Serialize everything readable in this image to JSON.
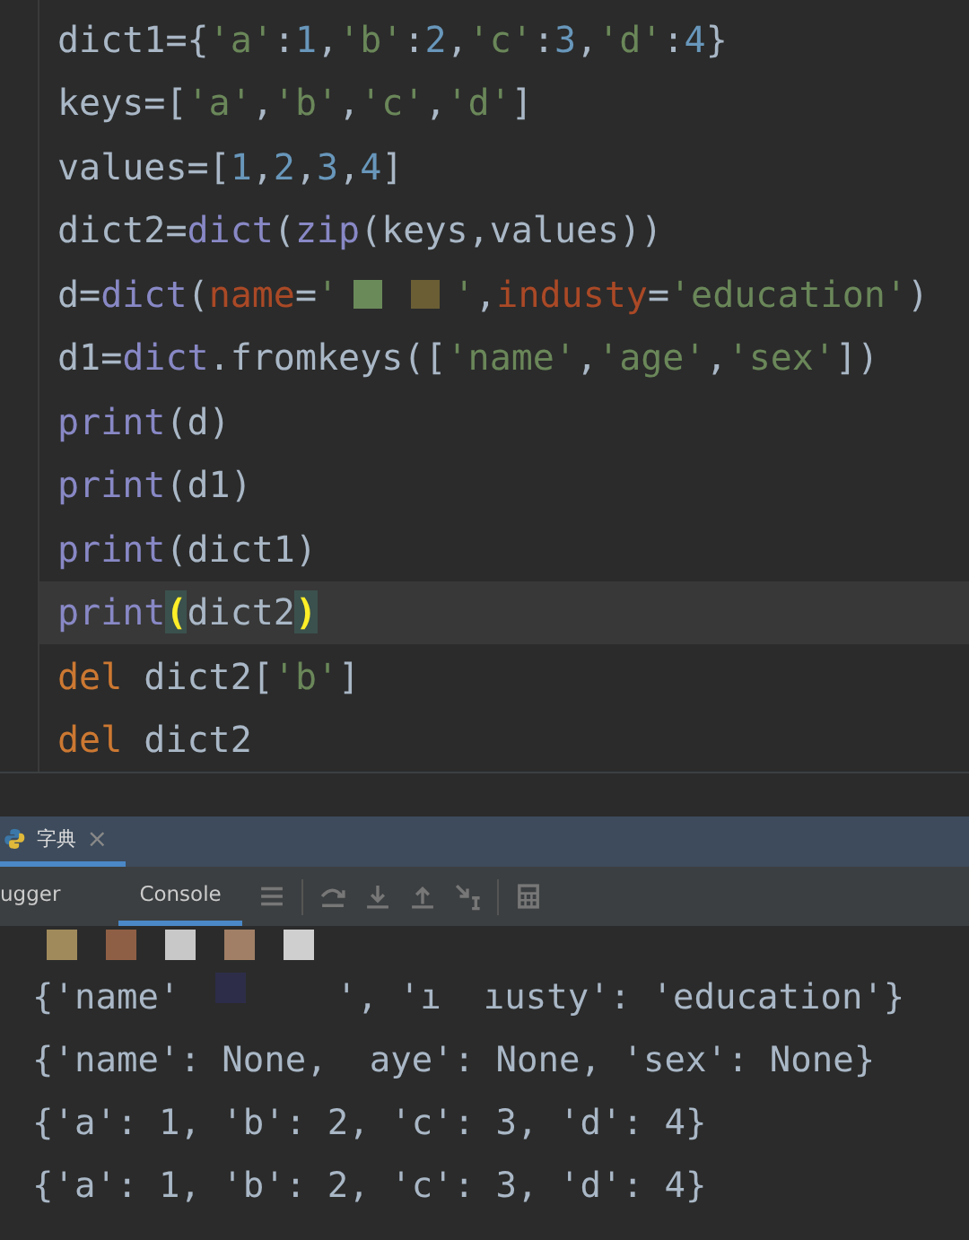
{
  "editor": {
    "lines": [
      {
        "current": false,
        "tokens": [
          {
            "kind": "plain",
            "text": "dict1={"
          },
          {
            "kind": "str",
            "text": "'a'"
          },
          {
            "kind": "plain",
            "text": ":"
          },
          {
            "kind": "num",
            "text": "1"
          },
          {
            "kind": "plain",
            "text": ","
          },
          {
            "kind": "str",
            "text": "'b'"
          },
          {
            "kind": "plain",
            "text": ":"
          },
          {
            "kind": "num",
            "text": "2"
          },
          {
            "kind": "plain",
            "text": ","
          },
          {
            "kind": "str",
            "text": "'c'"
          },
          {
            "kind": "plain",
            "text": ":"
          },
          {
            "kind": "num",
            "text": "3"
          },
          {
            "kind": "plain",
            "text": ","
          },
          {
            "kind": "str",
            "text": "'d'"
          },
          {
            "kind": "plain",
            "text": ":"
          },
          {
            "kind": "num",
            "text": "4"
          },
          {
            "kind": "plain",
            "text": "}"
          }
        ]
      },
      {
        "current": false,
        "tokens": [
          {
            "kind": "plain",
            "text": "keys=["
          },
          {
            "kind": "str",
            "text": "'a'"
          },
          {
            "kind": "plain",
            "text": ","
          },
          {
            "kind": "str",
            "text": "'b'"
          },
          {
            "kind": "plain",
            "text": ","
          },
          {
            "kind": "str",
            "text": "'c'"
          },
          {
            "kind": "plain",
            "text": ","
          },
          {
            "kind": "str",
            "text": "'d'"
          },
          {
            "kind": "plain",
            "text": "]"
          }
        ]
      },
      {
        "current": false,
        "tokens": [
          {
            "kind": "plain",
            "text": "values=["
          },
          {
            "kind": "num",
            "text": "1"
          },
          {
            "kind": "plain",
            "text": ","
          },
          {
            "kind": "num",
            "text": "2"
          },
          {
            "kind": "plain",
            "text": ","
          },
          {
            "kind": "num",
            "text": "3"
          },
          {
            "kind": "plain",
            "text": ","
          },
          {
            "kind": "num",
            "text": "4"
          },
          {
            "kind": "plain",
            "text": "]"
          }
        ]
      },
      {
        "current": false,
        "tokens": [
          {
            "kind": "plain",
            "text": "dict2="
          },
          {
            "kind": "builtin",
            "text": "dict"
          },
          {
            "kind": "plain",
            "text": "("
          },
          {
            "kind": "builtin",
            "text": "zip"
          },
          {
            "kind": "plain",
            "text": "(keys,values))"
          }
        ]
      },
      {
        "current": false,
        "tokens": [
          {
            "kind": "plain",
            "text": "d="
          },
          {
            "kind": "builtin",
            "text": "dict"
          },
          {
            "kind": "plain",
            "text": "("
          },
          {
            "kind": "kwarg",
            "text": "name"
          },
          {
            "kind": "plain",
            "text": "="
          },
          {
            "kind": "str",
            "text": "'"
          },
          {
            "kind": "block",
            "color": "#6a8a5a"
          },
          {
            "kind": "block",
            "color": "#6b5e35"
          },
          {
            "kind": "str",
            "text": "'"
          },
          {
            "kind": "plain",
            "text": ","
          },
          {
            "kind": "kwarg",
            "text": "industy"
          },
          {
            "kind": "plain",
            "text": "="
          },
          {
            "kind": "str",
            "text": "'education'"
          },
          {
            "kind": "plain",
            "text": ")"
          }
        ]
      },
      {
        "current": false,
        "tokens": [
          {
            "kind": "plain",
            "text": "d1="
          },
          {
            "kind": "builtin",
            "text": "dict"
          },
          {
            "kind": "plain",
            "text": ".fromkeys(["
          },
          {
            "kind": "str",
            "text": "'name'"
          },
          {
            "kind": "plain",
            "text": ","
          },
          {
            "kind": "str",
            "text": "'age'"
          },
          {
            "kind": "plain",
            "text": ","
          },
          {
            "kind": "str",
            "text": "'sex'"
          },
          {
            "kind": "plain",
            "text": "])"
          }
        ]
      },
      {
        "current": false,
        "tokens": [
          {
            "kind": "builtin",
            "text": "print"
          },
          {
            "kind": "plain",
            "text": "(d)"
          }
        ]
      },
      {
        "current": false,
        "tokens": [
          {
            "kind": "builtin",
            "text": "print"
          },
          {
            "kind": "plain",
            "text": "(d1)"
          }
        ]
      },
      {
        "current": false,
        "tokens": [
          {
            "kind": "builtin",
            "text": "print"
          },
          {
            "kind": "plain",
            "text": "(dict1)"
          }
        ]
      },
      {
        "current": true,
        "tokens": [
          {
            "kind": "builtin",
            "text": "print"
          },
          {
            "kind": "match",
            "text": "("
          },
          {
            "kind": "plain",
            "text": "dict2"
          },
          {
            "kind": "match",
            "text": ")"
          }
        ]
      },
      {
        "current": false,
        "tokens": [
          {
            "kind": "keyword",
            "text": "del"
          },
          {
            "kind": "plain",
            "text": " dict2["
          },
          {
            "kind": "str",
            "text": "'b'"
          },
          {
            "kind": "plain",
            "text": "]"
          }
        ]
      },
      {
        "current": false,
        "tokens": [
          {
            "kind": "keyword",
            "text": "del"
          },
          {
            "kind": "plain",
            "text": " dict2"
          }
        ]
      }
    ]
  },
  "run_tab": {
    "label": "字典",
    "close": "×"
  },
  "panel_tabs": [
    {
      "label": "ugger",
      "selected": false
    },
    {
      "label": "Console",
      "selected": true
    }
  ],
  "console": {
    "lines": [
      {
        "tokens": [
          {
            "kind": "block",
            "color": "#a08a5c"
          },
          {
            "kind": "block",
            "color": "#8f5f45"
          },
          {
            "kind": "block",
            "color": "#c8c8c8"
          },
          {
            "kind": "block",
            "color": "#a07f66"
          },
          {
            "kind": "block",
            "color": "#cfcfcf"
          }
        ]
      },
      {
        "tokens": [
          {
            "kind": "plain",
            "text": "{'name'"
          },
          {
            "kind": "block",
            "color": "#2d2d4a"
          },
          {
            "kind": "plain",
            "text": "', 'ı  ıusty': 'education'}"
          }
        ]
      },
      {
        "tokens": [
          {
            "kind": "plain",
            "text": "{'name': None,  aye': None, 'sex': None}"
          }
        ]
      },
      {
        "tokens": [
          {
            "kind": "plain",
            "text": "{'a': 1, 'b': 2, 'c': 3, 'd': 4}"
          }
        ]
      },
      {
        "tokens": [
          {
            "kind": "plain",
            "text": "{'a': 1, 'b': 2, 'c': 3, 'd': 4}"
          }
        ]
      }
    ]
  }
}
